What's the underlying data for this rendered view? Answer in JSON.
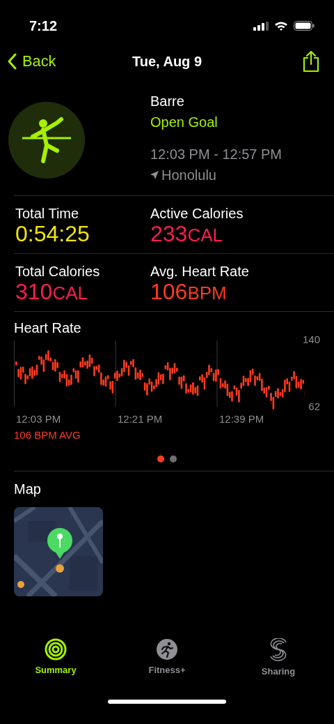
{
  "status_bar": {
    "time": "7:12"
  },
  "nav": {
    "back": "Back",
    "title": "Tue, Aug 9"
  },
  "workout": {
    "name": "Barre",
    "goal": "Open Goal",
    "time_range": "12:03 PM - 12:57 PM",
    "location": "Honolulu"
  },
  "metrics": [
    {
      "label": "Total Time",
      "value": "0:54:25",
      "color": "#f0e50a"
    },
    {
      "label": "Active Calories",
      "value": "233",
      "unit": "CAL",
      "color": "#fa1e50"
    },
    {
      "label": "Total Calories",
      "value": "310",
      "unit": "CAL",
      "color": "#fa1e50"
    },
    {
      "label": "Avg. Heart Rate",
      "value": "106",
      "unit": "BPM",
      "color": "#ff3b1f"
    }
  ],
  "heart_rate": {
    "title": "Heart Rate",
    "y_max": "140",
    "y_min": "62",
    "x_labels": [
      "12:03 PM",
      "12:21 PM",
      "12:39 PM"
    ],
    "average": "106 BPM AVG"
  },
  "pages": [
    {
      "selected": true
    },
    {
      "selected": false
    }
  ],
  "map": {
    "title": "Map"
  },
  "tabs": [
    {
      "label": "Summary",
      "kind": "rings",
      "selected": true
    },
    {
      "label": "Fitness+",
      "kind": "runner",
      "selected": false
    },
    {
      "label": "Sharing",
      "kind": "sharing",
      "selected": false
    }
  ]
}
